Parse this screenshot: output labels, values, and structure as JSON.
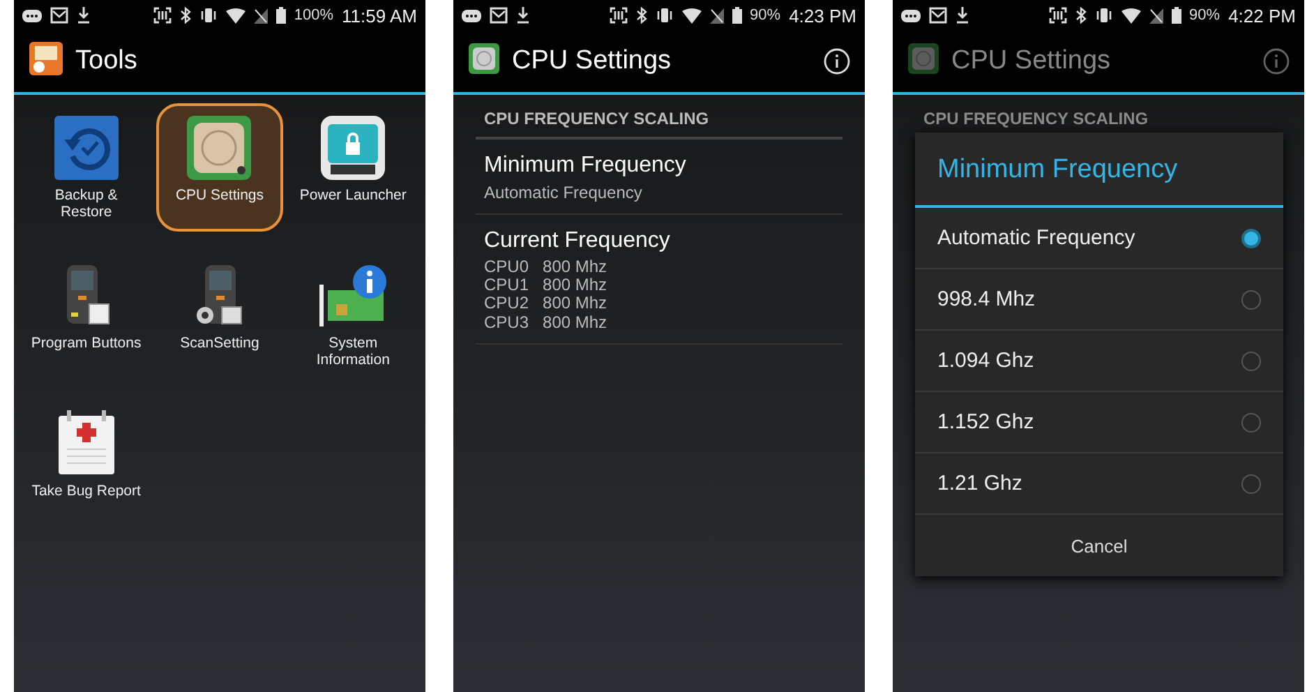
{
  "screens": [
    {
      "kind": "launcher",
      "status_bar": {
        "battery": "100%",
        "time": "11:59 AM"
      },
      "title": "Tools",
      "apps": [
        {
          "label": "Backup & Restore",
          "selected": false
        },
        {
          "label": "CPU Settings",
          "selected": true
        },
        {
          "label": "Power Launcher",
          "selected": false
        },
        {
          "label": "Program Buttons",
          "selected": false
        },
        {
          "label": "ScanSetting",
          "selected": false
        },
        {
          "label": "System Information",
          "selected": false
        },
        {
          "label": "Take Bug Report",
          "selected": false
        }
      ]
    },
    {
      "kind": "settings",
      "status_bar": {
        "battery": "90%",
        "time": "4:23 PM"
      },
      "title": "CPU Settings",
      "section": "CPU FREQUENCY SCALING",
      "items": [
        {
          "title": "Minimum Frequency",
          "summary": "Automatic Frequency"
        },
        {
          "title": "Current Frequency",
          "cpus": [
            {
              "name": "CPU0",
              "value": "800 Mhz"
            },
            {
              "name": "CPU1",
              "value": "800 Mhz"
            },
            {
              "name": "CPU2",
              "value": "800 Mhz"
            },
            {
              "name": "CPU3",
              "value": "800 Mhz"
            }
          ]
        }
      ]
    },
    {
      "kind": "dialog",
      "status_bar": {
        "battery": "90%",
        "time": "4:22 PM"
      },
      "title": "CPU Settings",
      "section": "CPU FREQUENCY SCALING",
      "dialog": {
        "title": "Minimum Frequency",
        "options": [
          {
            "label": "Automatic Frequency",
            "selected": true
          },
          {
            "label": "998.4 Mhz",
            "selected": false
          },
          {
            "label": "1.094 Ghz",
            "selected": false
          },
          {
            "label": "1.152 Ghz",
            "selected": false
          },
          {
            "label": "1.21 Ghz",
            "selected": false
          }
        ],
        "cancel": "Cancel"
      }
    }
  ]
}
